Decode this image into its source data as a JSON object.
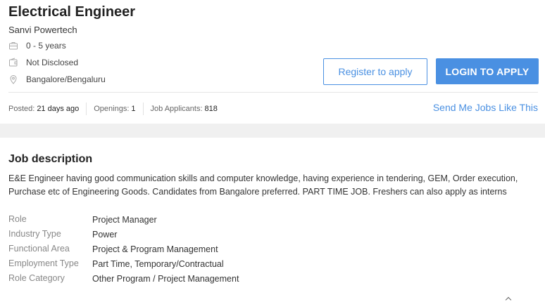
{
  "job": {
    "title": "Electrical Engineer",
    "company": "Sanvi Powertech",
    "experience": "0 - 5 years",
    "salary": "Not Disclosed",
    "location": "Bangalore/Bengaluru"
  },
  "actions": {
    "register_label": "Register to apply",
    "login_label": "LOGIN TO APPLY",
    "send_jobs_label": "Send Me Jobs Like This"
  },
  "stats": {
    "posted_label": "Posted:",
    "posted_value": "21 days ago",
    "openings_label": "Openings:",
    "openings_value": "1",
    "applicants_label": "Job Applicants:",
    "applicants_value": "818"
  },
  "description": {
    "heading": "Job description",
    "text": "E&E Engineer having good communication skills and computer knowledge, having experience in tendering, GEM, Order execution, Purchase etc of Engineering Goods. Candidates from Bangalore preferred. PART TIME JOB. Freshers can also apply as interns"
  },
  "details": [
    {
      "key": "Role",
      "value": "Project Manager"
    },
    {
      "key": "Industry Type",
      "value": "Power"
    },
    {
      "key": "Functional Area",
      "value": "Project & Program Management"
    },
    {
      "key": "Employment Type",
      "value": "Part Time, Temporary/Contractual"
    },
    {
      "key": "Role Category",
      "value": "Other Program / Project Management"
    }
  ],
  "icons": {
    "experience": "briefcase-icon",
    "salary": "wallet-icon",
    "location": "location-pin-icon"
  },
  "colors": {
    "accent": "#4a90e2"
  }
}
